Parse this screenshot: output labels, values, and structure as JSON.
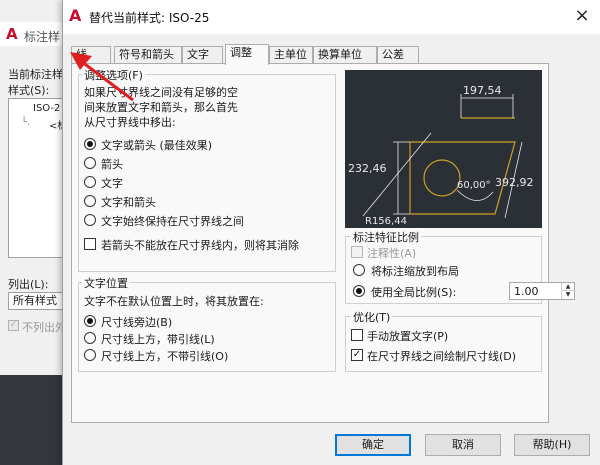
{
  "background_window": {
    "title": "标注样",
    "current_style_label": "当前标注样",
    "styles_label": "样式(S):",
    "list_items": [
      "ISO-2",
      "<标"
    ],
    "list_label": "列出(L):",
    "list_select_value": "所有样式",
    "exclude_checkbox_label": "不列出外"
  },
  "dialog": {
    "title": "替代当前样式: ISO-25",
    "close_label": "×",
    "tabs": [
      "线",
      "符号和箭头",
      "文字",
      "调整",
      "主单位",
      "换算单位",
      "公差"
    ],
    "active_tab": "调整"
  },
  "fit_options": {
    "title": "调整选项(F)",
    "description_lines": [
      "如果尺寸界线之间没有足够的空",
      "间来放置文字和箭头，那么首先",
      "从尺寸界线中移出:"
    ],
    "radios": [
      {
        "label": "文字或箭头 (最佳效果)",
        "checked": true
      },
      {
        "label": "箭头",
        "checked": false
      },
      {
        "label": "文字",
        "checked": false
      },
      {
        "label": "文字和箭头",
        "checked": false
      },
      {
        "label": "文字始终保持在尺寸界线之间",
        "checked": false
      }
    ],
    "suppress_checkbox": {
      "label": "若箭头不能放在尺寸界线内，则将其消除",
      "checked": false
    }
  },
  "text_placement": {
    "title": "文字位置",
    "description": "文字不在默认位置上时，将其放置在:",
    "radios": [
      {
        "label": "尺寸线旁边(B)",
        "checked": true
      },
      {
        "label": "尺寸线上方，带引线(L)",
        "checked": false
      },
      {
        "label": "尺寸线上方，不带引线(O)",
        "checked": false
      }
    ]
  },
  "preview": {
    "dim_top": "197,54",
    "dim_left": "232,46",
    "dim_right": "392,92",
    "dim_angle": "60,00°",
    "dim_radius": "R156,44"
  },
  "scale": {
    "title": "标注特征比例",
    "annotative_label": "注释性(A)",
    "scale_to_layout_label": "将标注缩放到布局",
    "use_overall_label": "使用全局比例(S):",
    "overall_value": "1.00"
  },
  "fine_tuning": {
    "title": "优化(T)",
    "manual_label": "手动放置文字(P)",
    "manual_checked": false,
    "draw_line_label": "在尺寸界线之间绘制尺寸线(D)",
    "draw_line_checked": true
  },
  "buttons": {
    "ok": "确定",
    "cancel": "取消",
    "help": "帮助(H)"
  },
  "colors": {
    "accent": "#0078d7",
    "logo": "#c8102e",
    "preview_bg": "#2b2f36",
    "preview_lines": "#c9a227",
    "annotation_arrow": "#e02020"
  }
}
